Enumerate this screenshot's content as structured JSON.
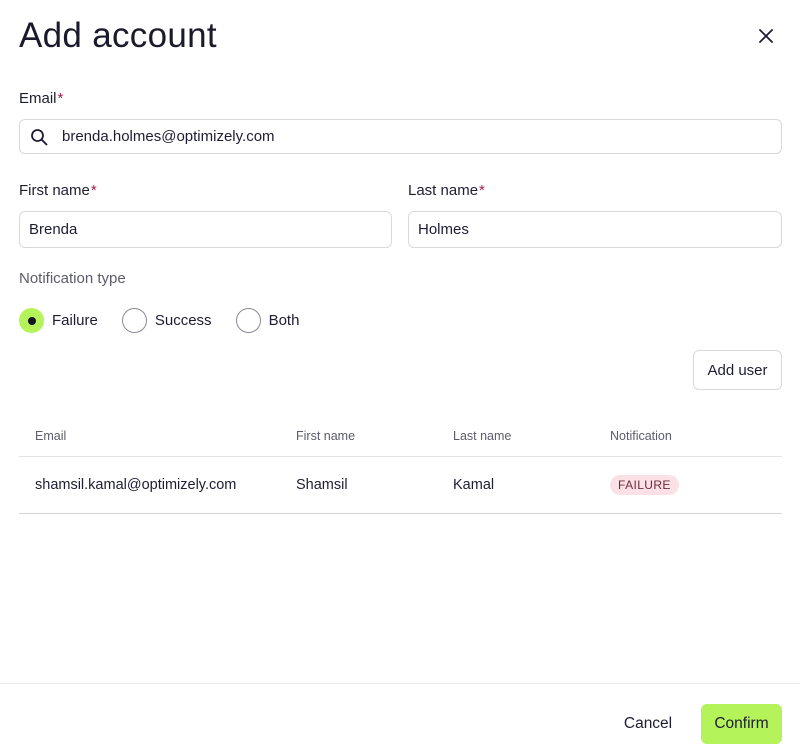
{
  "dialog": {
    "title": "Add account",
    "close_icon": "close-icon"
  },
  "form": {
    "email": {
      "label": "Email",
      "required_mark": "*",
      "value": "brenda.holmes@optimizely.com",
      "icon": "search-icon"
    },
    "first_name": {
      "label": "First name",
      "required_mark": "*",
      "value": "Brenda"
    },
    "last_name": {
      "label": "Last name",
      "required_mark": "*",
      "value": "Holmes"
    },
    "notification_type": {
      "label": "Notification type",
      "options": [
        {
          "label": "Failure",
          "selected": true
        },
        {
          "label": "Success",
          "selected": false
        },
        {
          "label": "Both",
          "selected": false
        }
      ]
    },
    "add_user_label": "Add user"
  },
  "table": {
    "headers": [
      "Email",
      "First name",
      "Last name",
      "Notification"
    ],
    "rows": [
      {
        "email": "shamsil.kamal@optimizely.com",
        "first_name": "Shamsil",
        "last_name": "Kamal",
        "notification": "FAILURE"
      }
    ]
  },
  "footer": {
    "cancel_label": "Cancel",
    "confirm_label": "Confirm"
  },
  "colors": {
    "accent": "#b4f45a",
    "required": "#a3204d",
    "failure_badge_bg": "#fbe0e6"
  }
}
